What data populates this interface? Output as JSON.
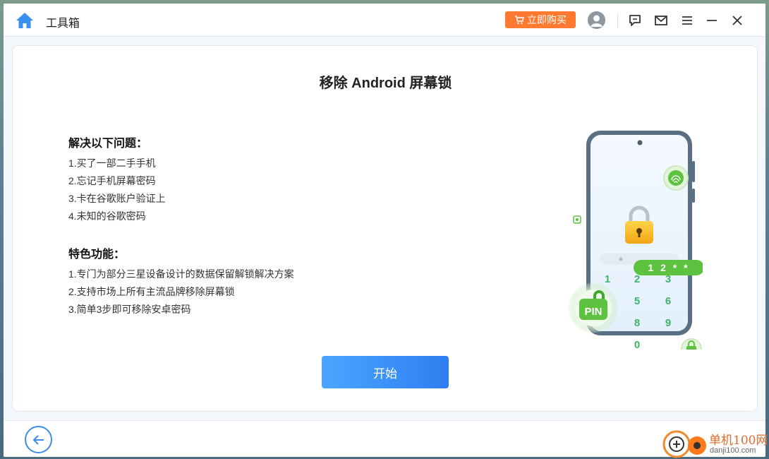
{
  "app": {
    "title": "工具箱",
    "buy_label": "立即购买"
  },
  "page": {
    "title": "移除 Android 屏幕锁"
  },
  "problems": {
    "title": "解决以下问题：",
    "items": [
      "1.买了一部二手手机",
      "2.忘记手机屏幕密码",
      "3.卡在谷歌账户验证上",
      "4.未知的谷歌密码"
    ]
  },
  "features": {
    "title": "特色功能：",
    "items": [
      "1.专门为部分三星设备设计的数据保留解锁解决方案",
      "2.支持市场上所有主流品牌移除屏幕锁",
      "3.简单3步即可移除安卓密码"
    ]
  },
  "start_label": "开始",
  "illustration": {
    "pin_badge": "PIN",
    "code_badge": "1 2 * *",
    "keypad": [
      "1",
      "2",
      "3",
      "5",
      "6",
      "8",
      "9",
      "0"
    ]
  },
  "watermark": {
    "name": "单机100网",
    "url": "danji100.com"
  },
  "colors": {
    "accent": "#2f7ef0",
    "buy": "#ff7a30",
    "green": "#5cc23f"
  }
}
